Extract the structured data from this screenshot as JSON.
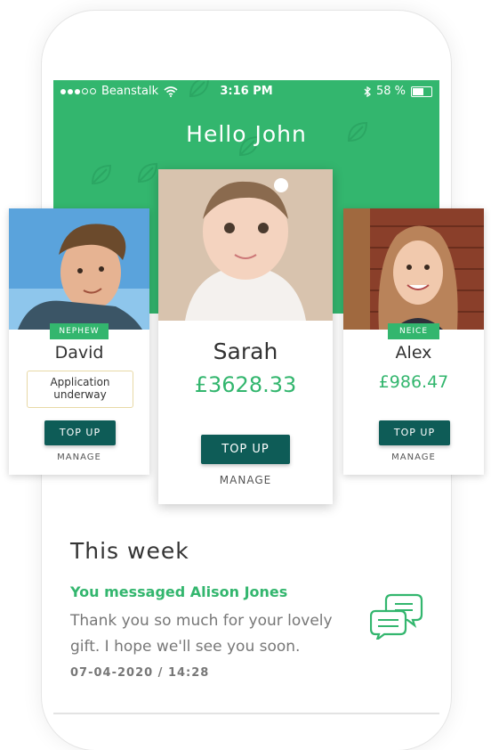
{
  "status_bar": {
    "carrier": "Beanstalk",
    "time": "3:16 PM",
    "battery": "58 %",
    "battery_level": 0.58
  },
  "header": {
    "greeting": "Hello John"
  },
  "children": [
    {
      "name": "David",
      "relation": "NEPHEW",
      "status": "Application underway",
      "button": "TOP UP",
      "manage": "MANAGE"
    },
    {
      "name": "Sarah",
      "amount": "£3628.33",
      "button": "TOP UP",
      "manage": "MANAGE"
    },
    {
      "name": "Alex",
      "relation": "NEICE",
      "amount": "£986.47",
      "button": "TOP UP",
      "manage": "MANAGE"
    }
  ],
  "this_week": {
    "title": "This week",
    "message_title": "You messaged Alison Jones",
    "message_body": "Thank you so much for your lovely gift. I hope we'll see you soon.",
    "timestamp": "07-04-2020 / 14:28"
  },
  "colors": {
    "brand_green": "#33b66e",
    "button_teal": "#0e5c57"
  },
  "icons": [
    "wifi-icon",
    "bluetooth-icon",
    "battery-icon",
    "leaf-icon",
    "chat-bubbles-icon"
  ]
}
